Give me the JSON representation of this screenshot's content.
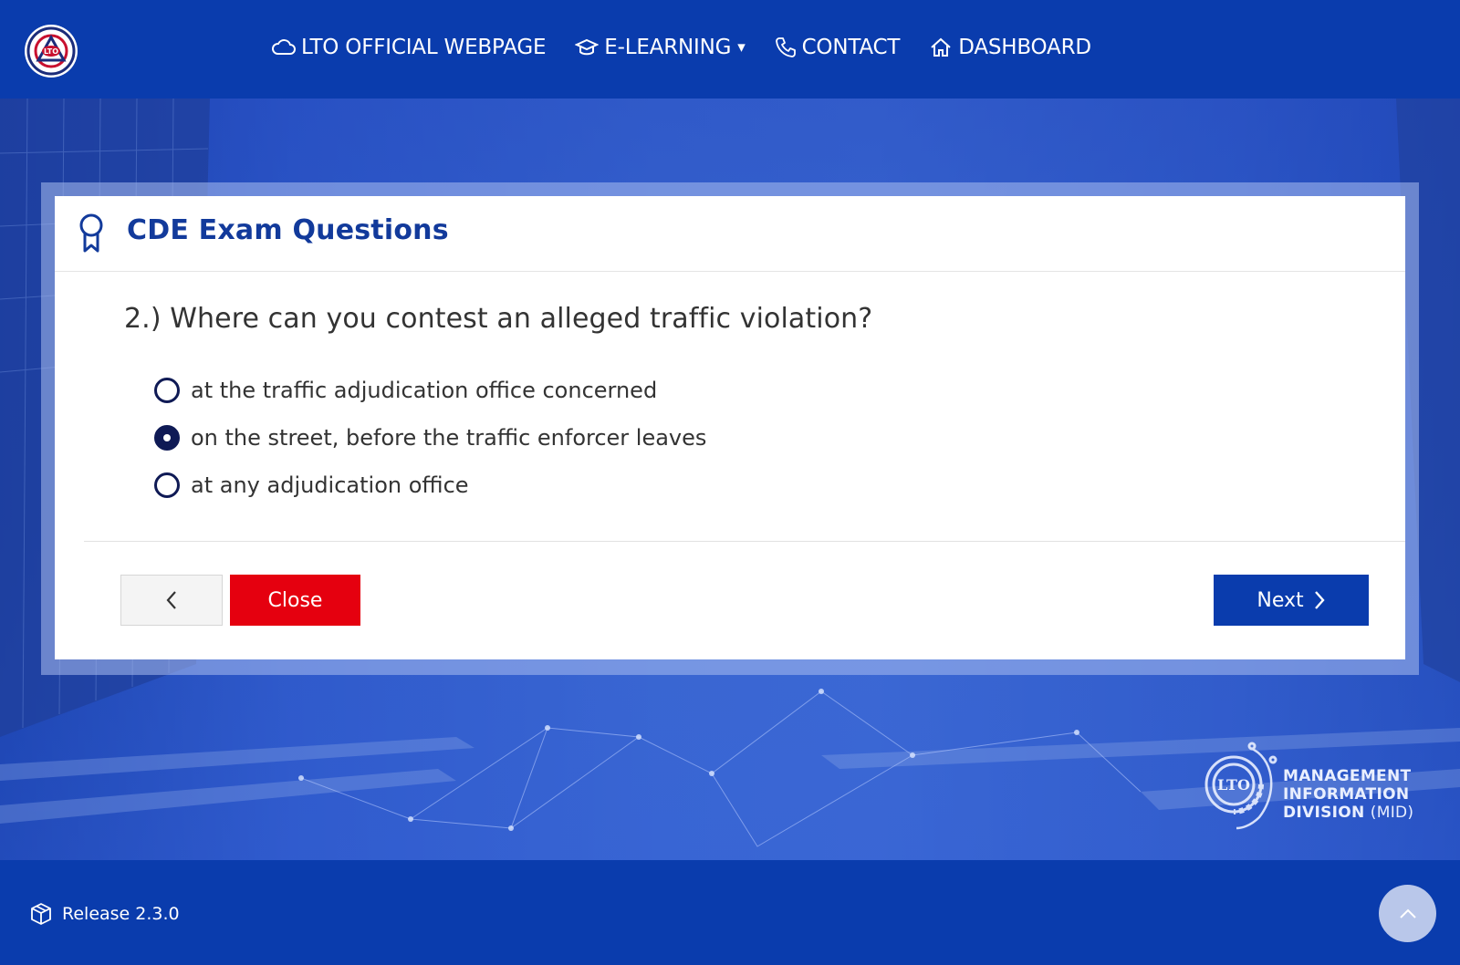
{
  "header": {
    "logo_icon": "lto-seal-icon",
    "nav": [
      {
        "label": "LTO OFFICIAL WEBPAGE",
        "icon": "cloud-icon"
      },
      {
        "label": "E-LEARNING",
        "icon": "graduation-cap-icon",
        "caret": "▾"
      },
      {
        "label": "CONTACT",
        "icon": "phone-icon"
      },
      {
        "label": "DASHBOARD",
        "icon": "home-icon"
      }
    ]
  },
  "modal": {
    "title": "CDE Exam Questions",
    "title_icon": "award-ribbon-icon",
    "question": "2.) Where can you contest an alleged traffic violation?",
    "options": [
      {
        "label": "at the traffic adjudication office concerned",
        "selected": false
      },
      {
        "label": "on the street, before the traffic enforcer leaves",
        "selected": true
      },
      {
        "label": "at any adjudication office",
        "selected": false
      }
    ],
    "buttons": {
      "back_icon": "chevron-left-icon",
      "close": "Close",
      "next": "Next",
      "next_icon": "chevron-right-icon"
    }
  },
  "watermark": {
    "line1": "MANAGEMENT",
    "line2": "INFORMATION",
    "line3": "DIVISION",
    "abbr": "(MID)"
  },
  "footer": {
    "release": "Release 2.3.0",
    "release_icon": "box-icon",
    "to_top_icon": "chevron-up-icon"
  },
  "colors": {
    "brand_blue": "#0a3cad",
    "title_blue": "#123a9b",
    "close_red": "#e5000f",
    "radio_navy": "#0f1a55"
  }
}
